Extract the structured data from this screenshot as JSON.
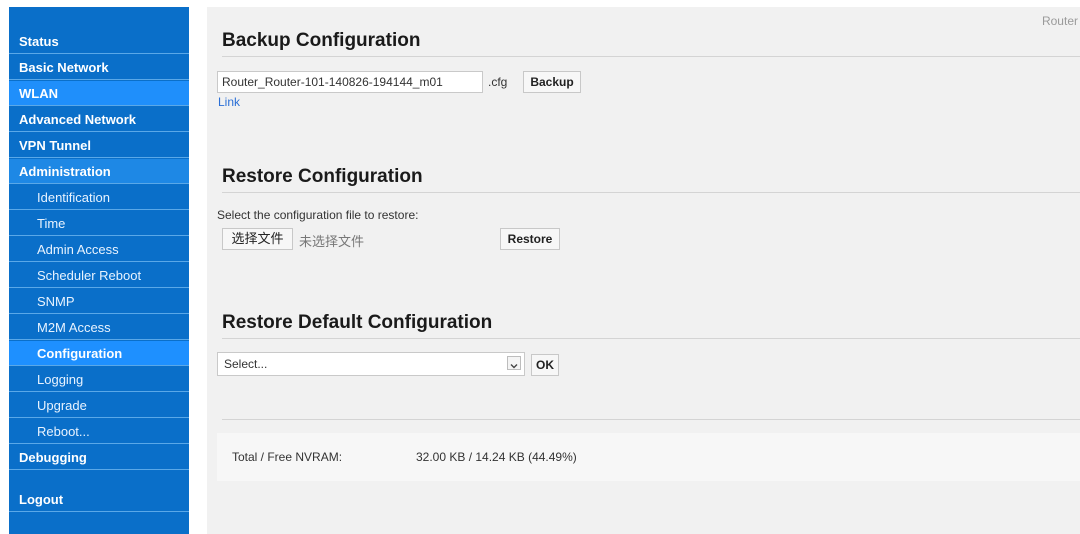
{
  "sidebar": {
    "items": [
      {
        "label": "Status"
      },
      {
        "label": "Basic Network"
      },
      {
        "label": "WLAN"
      },
      {
        "label": "Advanced Network"
      },
      {
        "label": "VPN Tunnel"
      },
      {
        "label": "Administration"
      }
    ],
    "sub_items": [
      {
        "label": "Identification"
      },
      {
        "label": "Time"
      },
      {
        "label": "Admin Access"
      },
      {
        "label": "Scheduler Reboot"
      },
      {
        "label": "SNMP"
      },
      {
        "label": "M2M Access"
      },
      {
        "label": "Configuration"
      },
      {
        "label": "Logging"
      },
      {
        "label": "Upgrade"
      },
      {
        "label": "Reboot..."
      }
    ],
    "bottom_items": [
      {
        "label": "Debugging"
      },
      {
        "label": "Logout"
      }
    ]
  },
  "header": {
    "corner_label": "Router"
  },
  "backup": {
    "title": "Backup Configuration",
    "filename": "Router_Router-101-140826-194144_m01",
    "ext": ".cfg",
    "button": "Backup",
    "link": "Link"
  },
  "restore": {
    "title": "Restore Configuration",
    "prompt": "Select the configuration file to restore:",
    "choose_button": "选择文件",
    "no_file": "未选择文件",
    "button": "Restore"
  },
  "restore_default": {
    "title": "Restore Default Configuration",
    "select_value": "Select...",
    "ok_button": "OK"
  },
  "nvram": {
    "label": "Total / Free NVRAM:",
    "value": "32.00 KB / 14.24 KB (44.49%)"
  }
}
